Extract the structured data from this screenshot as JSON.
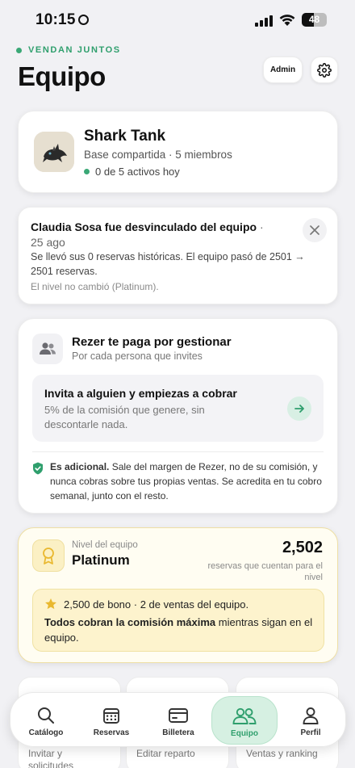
{
  "status_bar": {
    "time": "10:15",
    "battery": "48"
  },
  "header": {
    "eyebrow": "VENDAN JUNTOS",
    "title": "Equipo",
    "admin_label": "Admin"
  },
  "team": {
    "name": "Shark Tank",
    "subtitle": "Base compartida · 5 miembros",
    "active": "0 de 5 activos hoy"
  },
  "notice": {
    "title": "Claudia Sosa fue desvinculado del equipo",
    "date": "· 25 ago",
    "body": "Se llevó sus 0 reservas históricas. El equipo pasó de 2501 → 2501 reservas.",
    "footer": "El nivel no cambió (Platinum)."
  },
  "earn": {
    "title": "Rezer te paga por gestionar",
    "subtitle": "Por cada persona que invites",
    "invite_title": "Invita a alguien y empiezas a cobrar",
    "invite_subtitle": "5% de la comisión que genere, sin descontarle nada.",
    "note_bold": "Es adicional.",
    "note_text": " Sale del margen de Rezer, no de su comisión, y nunca cobras sobre tus propias ventas. Se acredita en tu cobro semanal, junto con el resto."
  },
  "level": {
    "label": "Nivel del equipo",
    "name": "Platinum",
    "count": "2,502",
    "count_label": "reservas que cuentan para el nivel",
    "bonus": "2,500 de bono · 2 de ventas del equipo.",
    "desc_bold": "Todos cobran la comisión máxima",
    "desc_text": " mientras sigan en el equipo."
  },
  "bottom_cards": [
    {
      "label": "Invitar y solicitudes"
    },
    {
      "label": "Editar reparto"
    },
    {
      "label": "Ventas y ranking"
    }
  ],
  "tabs": [
    {
      "label": "Catálogo",
      "icon": "search-icon"
    },
    {
      "label": "Reservas",
      "icon": "calendar-icon"
    },
    {
      "label": "Billetera",
      "icon": "wallet-icon"
    },
    {
      "label": "Equipo",
      "icon": "team-icon",
      "active": true
    },
    {
      "label": "Perfil",
      "icon": "person-icon"
    }
  ],
  "colors": {
    "accent": "#2f9f6d",
    "gold": "#e9b82f"
  }
}
